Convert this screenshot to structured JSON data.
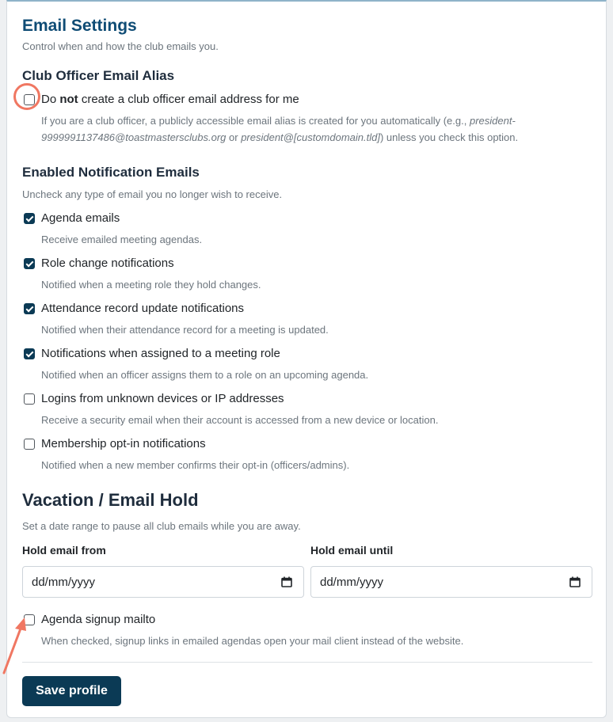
{
  "email_settings": {
    "title": "Email Settings",
    "subtitle": "Control when and how the club emails you."
  },
  "alias": {
    "heading": "Club Officer Email Alias",
    "checkbox": {
      "checked": false,
      "label_pre": "Do ",
      "label_bold": "not",
      "label_post": " create a club officer email address for me"
    },
    "desc_1": "If you are a club officer, a publicly accessible email alias is created for you automatically (e.g., ",
    "desc_example_1": "president-9999991137486@toastmastersclubs.org",
    "desc_or": " or ",
    "desc_example_2": "president@[customdomain.tld]",
    "desc_2": ") unless you check this option."
  },
  "notifications": {
    "heading": "Enabled Notification Emails",
    "subtitle": "Uncheck any type of email you no longer wish to receive.",
    "items": [
      {
        "label": "Agenda emails",
        "desc": "Receive emailed meeting agendas.",
        "checked": true
      },
      {
        "label": "Role change notifications",
        "desc": "Notified when a meeting role they hold changes.",
        "checked": true
      },
      {
        "label": "Attendance record update notifications",
        "desc": "Notified when their attendance record for a meeting is updated.",
        "checked": true
      },
      {
        "label": "Notifications when assigned to a meeting role",
        "desc": "Notified when an officer assigns them to a role on an upcoming agenda.",
        "checked": true
      },
      {
        "label": "Logins from unknown devices or IP addresses",
        "desc": "Receive a security email when their account is accessed from a new device or location.",
        "checked": false
      },
      {
        "label": "Membership opt-in notifications",
        "desc": "Notified when a new member confirms their opt-in (officers/admins).",
        "checked": false
      }
    ]
  },
  "vacation": {
    "heading": "Vacation / Email Hold",
    "subtitle": "Set a date range to pause all club emails while you are away.",
    "from_label": "Hold email from",
    "until_label": "Hold email until",
    "from_placeholder": "dd/mm/yyyy",
    "until_placeholder": "dd/mm/yyyy"
  },
  "mailto": {
    "label": "Agenda signup mailto",
    "desc": "When checked, signup links in emailed agendas open your mail client instead of the website.",
    "checked": false
  },
  "actions": {
    "save_label": "Save profile"
  },
  "colors": {
    "brand_heading": "#0f4c75",
    "checkbox_checked": "#0b3a55",
    "annotation": "#f07762"
  },
  "icons": {
    "date_picker": "calendar-icon",
    "checkmark": "check-icon"
  }
}
